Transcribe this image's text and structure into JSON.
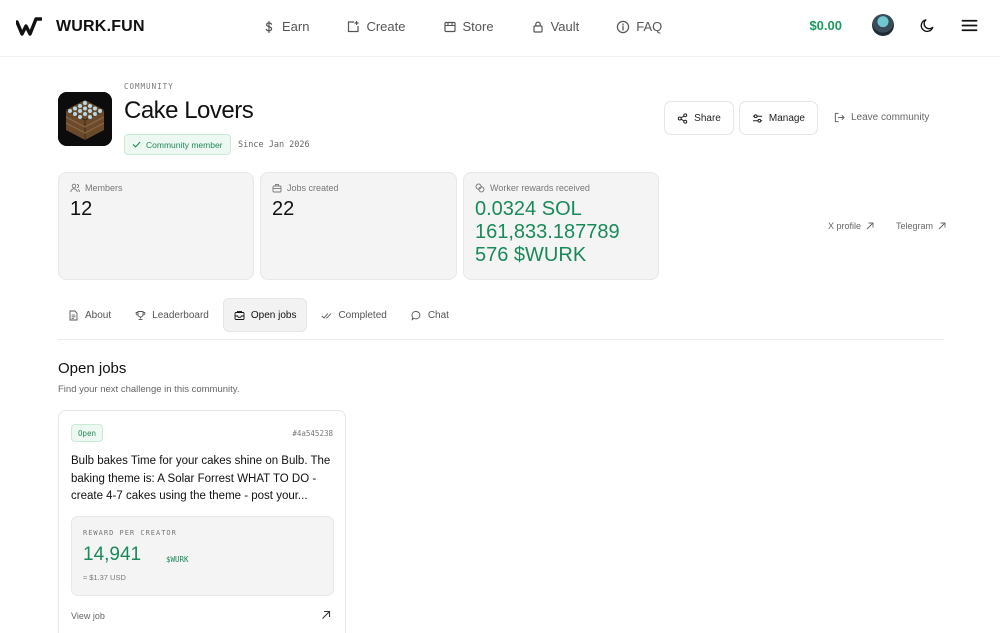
{
  "brand": {
    "name": "WURK.FUN"
  },
  "nav": {
    "links": [
      {
        "label": "Earn",
        "icon": "dollar-icon"
      },
      {
        "label": "Create",
        "icon": "create-icon"
      },
      {
        "label": "Store",
        "icon": "store-icon"
      },
      {
        "label": "Vault",
        "icon": "lock-icon"
      },
      {
        "label": "FAQ",
        "icon": "info-icon"
      }
    ],
    "balance": "$0.00"
  },
  "community": {
    "kicker": "COMMUNITY",
    "title": "Cake Lovers",
    "badge": "Community member",
    "since": "Since Jan 2026",
    "actions": {
      "share": "Share",
      "manage": "Manage",
      "leave": "Leave community"
    }
  },
  "stats": {
    "members": {
      "label": "Members",
      "value": "12"
    },
    "jobs": {
      "label": "Jobs created",
      "value": "22"
    },
    "rewards": {
      "label": "Worker rewards received",
      "sol": "0.0324 SOL",
      "wurk_line1": "161,833.187789",
      "wurk_line2": "576 $WURK"
    }
  },
  "external": {
    "x": "X profile",
    "telegram": "Telegram"
  },
  "tabs": [
    "About",
    "Leaderboard",
    "Open jobs",
    "Completed",
    "Chat"
  ],
  "section": {
    "title": "Open jobs",
    "subtitle": "Find your next challenge in this community."
  },
  "job": {
    "status": "Open",
    "id": "#4a545238",
    "description": "Bulb bakes Time for your cakes shine on Bulb. The baking theme is: A Solar Forrest WHAT TO DO - create 4-7 cakes using the theme - post your...",
    "reward_kicker": "REWARD PER CREATOR",
    "reward_amount": "14,941",
    "reward_unit": "$WURK",
    "reward_usd": "≈ $1.37 USD",
    "view": "View job"
  },
  "colors": {
    "accent": "#1a8a5a",
    "balance": "#1a9a5c"
  }
}
